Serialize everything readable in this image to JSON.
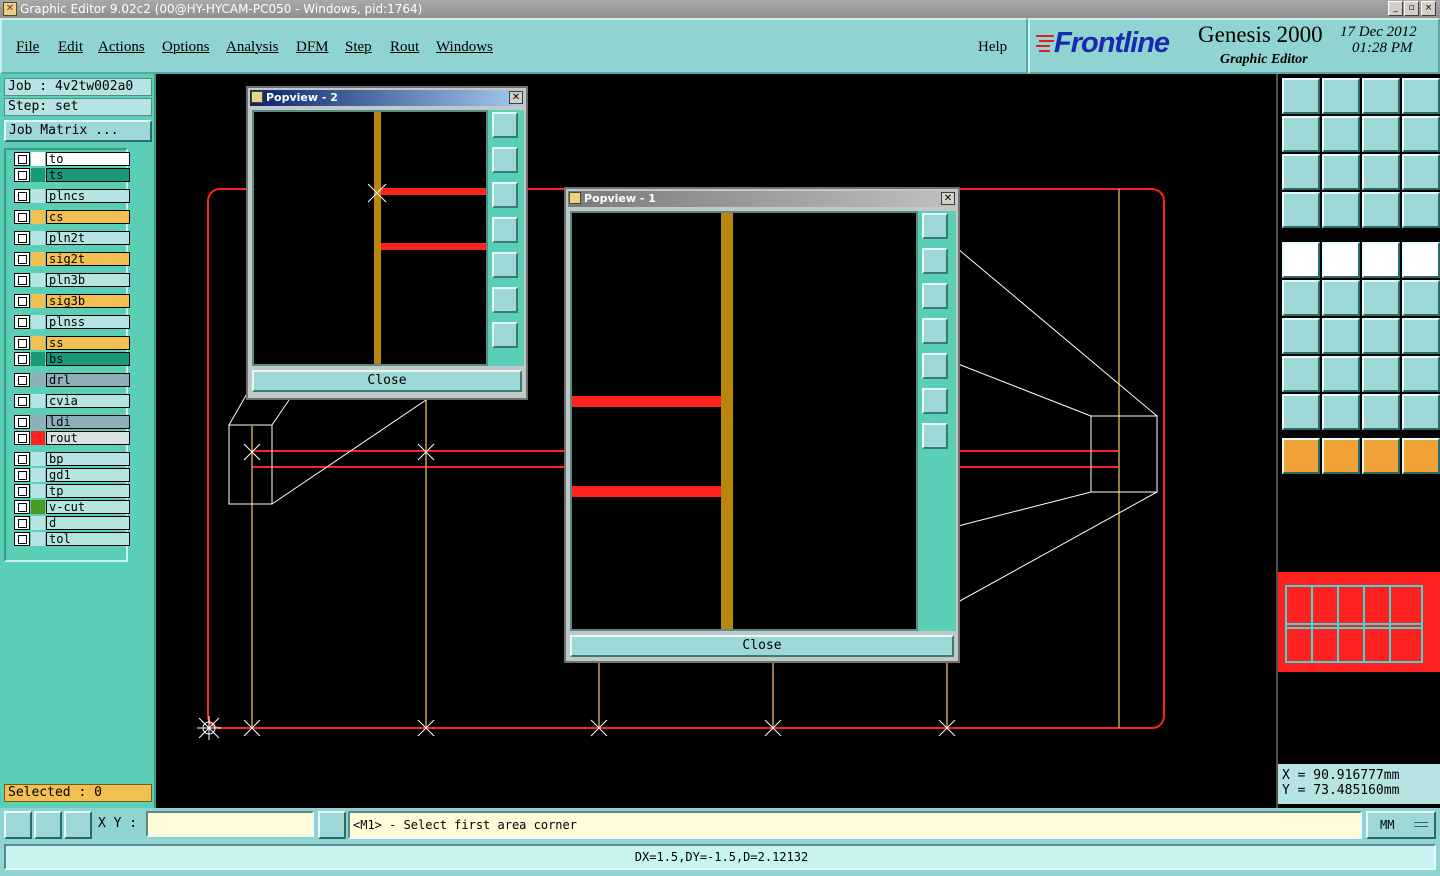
{
  "window": {
    "title": "Graphic Editor 9.02c2 (00@HY-HYCAM-PC050 - Windows, pid:1764)",
    "controls": [
      "_",
      "▫",
      "×"
    ]
  },
  "menu": {
    "items": [
      "File",
      "Edit",
      "Actions",
      "Options",
      "Analysis",
      "DFM",
      "Step",
      "Rout",
      "Windows"
    ],
    "help": "Help"
  },
  "brand": {
    "logo": "Frontline",
    "product": "Genesis 2000",
    "subtitle": "Graphic Editor",
    "date": "17 Dec 2012",
    "time": "01:28 PM"
  },
  "job": {
    "job_label": "Job : 4v2tw002a0",
    "step_label": "Step: set",
    "matrix_button": "Job Matrix ..."
  },
  "layers": [
    {
      "name": "to",
      "bg": "#ffffff",
      "color": ""
    },
    {
      "name": "ts",
      "bg": "#1a9a78",
      "color": ""
    },
    {
      "name": "plncs",
      "bg": "#b6e4e2",
      "color": ""
    },
    {
      "name": "cs",
      "bg": "#f2c050",
      "color": ""
    },
    {
      "name": "pln2t",
      "bg": "#b6e4e2",
      "color": ""
    },
    {
      "name": "sig2t",
      "bg": "#f2c050",
      "color": ""
    },
    {
      "name": "pln3b",
      "bg": "#b6e4e2",
      "color": ""
    },
    {
      "name": "sig3b",
      "bg": "#f2c050",
      "color": ""
    },
    {
      "name": "plnss",
      "bg": "#b6e4e2",
      "color": ""
    },
    {
      "name": "ss",
      "bg": "#f2c050",
      "color": ""
    },
    {
      "name": "bs",
      "bg": "#1a9a78",
      "color": ""
    },
    {
      "name": "drl",
      "bg": "#8fb0b8",
      "color": ""
    },
    {
      "name": "cvia",
      "bg": "#b6e4e2",
      "color": ""
    },
    {
      "name": "ldi",
      "bg": "#8fb0b8",
      "color": ""
    },
    {
      "name": "rout",
      "bg": "#d8e0e0",
      "color": "#ff2020"
    },
    {
      "name": "bp",
      "bg": "#b6e4e2",
      "color": ""
    },
    {
      "name": "gd1",
      "bg": "#b6e4e2",
      "color": ""
    },
    {
      "name": "tp",
      "bg": "#b6e4e2",
      "color": ""
    },
    {
      "name": "v-cut",
      "bg": "#b6e4e2",
      "color": "#4a9a20"
    },
    {
      "name": "d",
      "bg": "#b6e4e2",
      "color": ""
    },
    {
      "name": "tol",
      "bg": "#b6e4e2",
      "color": ""
    }
  ],
  "selected": "Selected : 0",
  "popview2": {
    "title": "Popview - 2",
    "close": "Close"
  },
  "popview1": {
    "title": "Popview - 1",
    "close": "Close"
  },
  "coords": {
    "x": "X =  90.916777mm",
    "y": "Y =  73.485160mm"
  },
  "bottom": {
    "xy_label": "X Y :",
    "xy_value": "",
    "prompt": "<M1> - Select first area corner",
    "units": "MM",
    "measure": "DX=1.5,DY=-1.5,D=2.12132"
  },
  "colors": {
    "rout": "#ff2020",
    "drill": "#b8860b",
    "panel": "#5bcfb6"
  }
}
